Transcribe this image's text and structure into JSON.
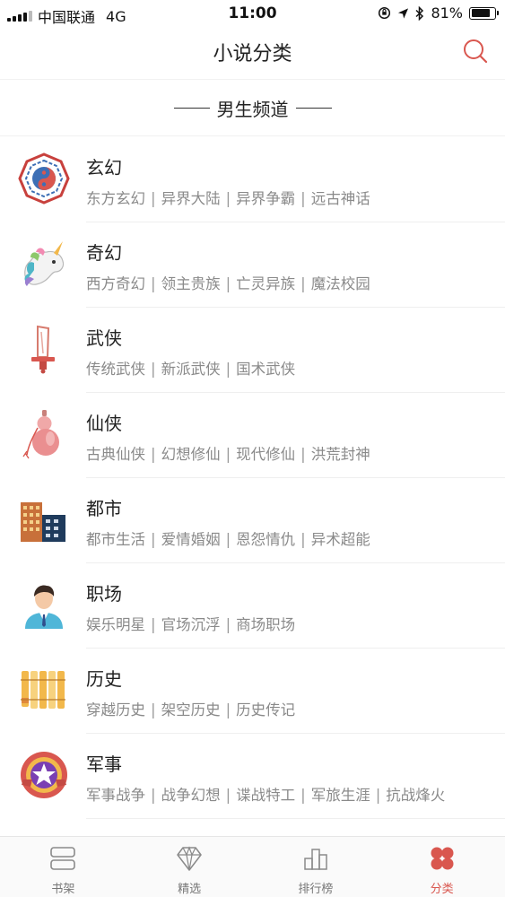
{
  "status_bar": {
    "carrier": "中国联通",
    "network": "4G",
    "time": "11:00",
    "battery": "81%",
    "battery_level": 0.81
  },
  "header": {
    "title": "小说分类",
    "search_icon": "search-icon"
  },
  "section": {
    "title": "男生频道"
  },
  "categories": [
    {
      "name": "玄幻",
      "icon": "yin-yang-icon",
      "subs": [
        "东方玄幻",
        "异界大陆",
        "异界争霸",
        "远古神话"
      ]
    },
    {
      "name": "奇幻",
      "icon": "unicorn-icon",
      "subs": [
        "西方奇幻",
        "领主贵族",
        "亡灵异族",
        "魔法校园"
      ]
    },
    {
      "name": "武侠",
      "icon": "sword-icon",
      "subs": [
        "传统武侠",
        "新派武侠",
        "国术武侠"
      ]
    },
    {
      "name": "仙侠",
      "icon": "gourd-icon",
      "subs": [
        "古典仙侠",
        "幻想修仙",
        "现代修仙",
        "洪荒封神"
      ]
    },
    {
      "name": "都市",
      "icon": "buildings-icon",
      "subs": [
        "都市生活",
        "爱情婚姻",
        "恩怨情仇",
        "异术超能"
      ]
    },
    {
      "name": "职场",
      "icon": "businessman-icon",
      "subs": [
        "娱乐明星",
        "官场沉浮",
        "商场职场"
      ]
    },
    {
      "name": "历史",
      "icon": "bamboo-scroll-icon",
      "subs": [
        "穿越历史",
        "架空历史",
        "历史传记"
      ]
    },
    {
      "name": "军事",
      "icon": "military-badge-icon",
      "subs": [
        "军事战争",
        "战争幻想",
        "谍战特工",
        "军旅生涯",
        "抗战烽火"
      ]
    }
  ],
  "tabs": [
    {
      "label": "书架",
      "icon": "bookshelf-icon",
      "active": false
    },
    {
      "label": "精选",
      "icon": "diamond-icon",
      "active": false
    },
    {
      "label": "排行榜",
      "icon": "ranking-icon",
      "active": false
    },
    {
      "label": "分类",
      "icon": "category-icon",
      "active": true
    }
  ],
  "colors": {
    "accent": "#d9574f",
    "text": "#222222",
    "muted": "#8a8a8a"
  }
}
